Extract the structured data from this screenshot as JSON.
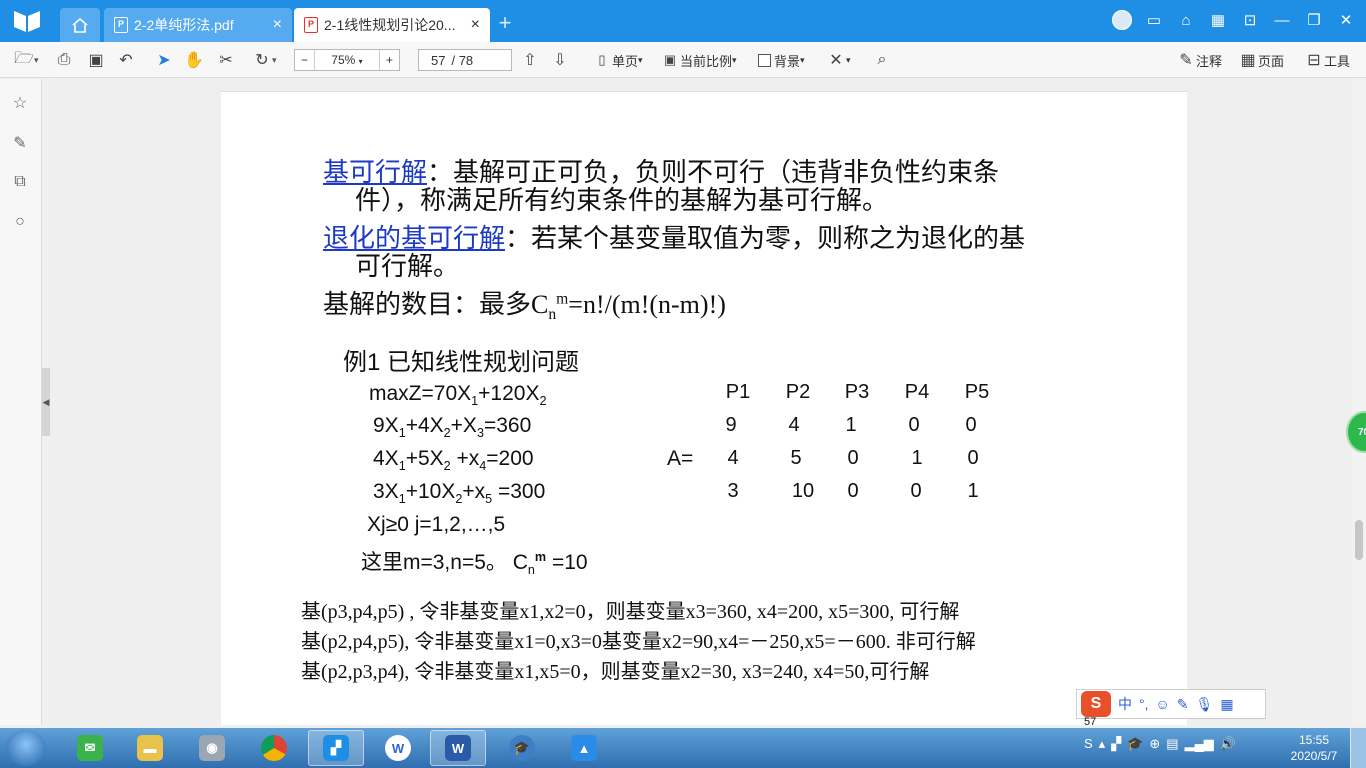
{
  "app": {
    "tabs": [
      {
        "label": "2-2单纯形法.pdf"
      },
      {
        "label": "2-1线性规划引论20..."
      }
    ],
    "new_tab": "+"
  },
  "toolbar": {
    "zoom_minus": "−",
    "zoom_value": "75%",
    "zoom_plus": "+",
    "page_current": "57",
    "page_total": "/ 78",
    "single_page": "单页",
    "current_ratio": "当前比例",
    "background": "背景",
    "annotate": "注释",
    "page_label": "页面",
    "tools": "工具"
  },
  "doc": {
    "p1_term": "基可行解",
    "p1_text_a": "：基解可正可负，负则不可行（违背非负性约束条",
    "p1_text_b": "件），称满足所有约束条件的基解为基可行解。",
    "p2_term": "退化的基可行解",
    "p2_text_a": "：若某个基变量取值为零，则称之为退化的基",
    "p2_text_b": "可行解。",
    "p3_text": "基解的数目：最多C",
    "p3_sub": "n",
    "p3_sup": "m",
    "p3_tail": "=n!/(m!(n-m)!)",
    "example_title": "例1 已知线性规划问题",
    "obj": "maxZ=70X",
    "obj_s1": "1",
    "obj_mid": "+120X",
    "obj_s2": "2",
    "c1_a": "9X",
    "c1_s1": "1",
    "c1_b": "+4X",
    "c1_s2": "2",
    "c1_c": "+X",
    "c1_s3": "3",
    "c1_d": "=360",
    "c2_a": "4X",
    "c2_s1": "1",
    "c2_b": "+5X",
    "c2_s2": "2",
    "c2_c": " +x",
    "c2_s3": "4",
    "c2_d": "=200",
    "c3_a": "3X",
    "c3_s1": "1",
    "c3_b": "+10X",
    "c3_s2": "2",
    "c3_c": "+x",
    "c3_s3": "5",
    "c3_d": " =300",
    "nonneg": "Xj≥0   j=1,2,…,5",
    "here": "这里m=3,n=5。 C",
    "here_sub": "n",
    "here_sup": "m",
    "here_tail": " =10",
    "matrix_label": "A=",
    "matrix_headers": [
      "P1",
      "P2",
      "P3",
      "P4",
      "P5"
    ],
    "matrix_rows": [
      [
        "9",
        "4",
        "1",
        "0",
        "0"
      ],
      [
        "4",
        "5",
        "0",
        "1",
        "0"
      ],
      [
        "3",
        "10",
        "0",
        "0",
        "1"
      ]
    ],
    "basis_lines": [
      "基(p3,p4,p5) , 令非基变量x1,x2=0，则基变量x3=360,    x4=200,    x5=300,    可行解",
      "基(p2,p4,p5), 令非基变量x1=0,x3=0基变量x2=90,x4=－250,x5=－600.    非可行解",
      "基(p2,p3,p4), 令非基变量x1,x5=0，则基变量x2=30,    x3=240,    x4=50,可行解"
    ]
  },
  "side_badge": "70",
  "ime": {
    "logo": "S",
    "lang": "中",
    "punct": "°,"
  },
  "page_indicator": "57",
  "clock": {
    "time": "15:55",
    "date": "2020/5/7"
  }
}
